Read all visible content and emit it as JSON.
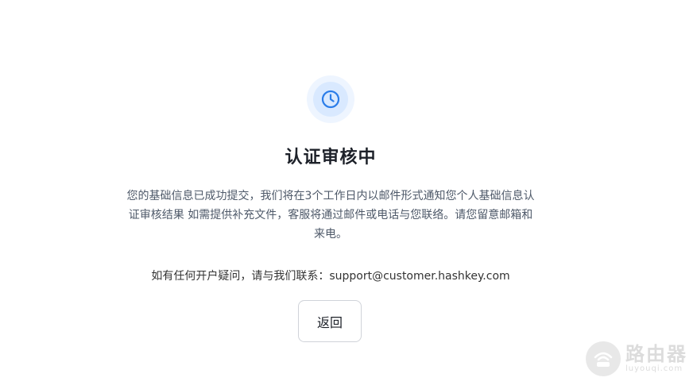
{
  "status": {
    "icon": "clock-icon",
    "accent_color": "#2b7de9",
    "title": "认证审核中",
    "description": "您的基础信息已成功提交，我们将在3个工作日内以邮件形式通知您个人基础信息认证审核结果 如需提供补充文件，客服将通过邮件或电话与您联络。请您留意邮箱和来电。",
    "contact": "如有任何开户疑问，请与我们联系：support@customer.hashkey.com"
  },
  "actions": {
    "back_label": "返回"
  },
  "watermark": {
    "name": "路由器",
    "domain": "luyouqi.com"
  }
}
